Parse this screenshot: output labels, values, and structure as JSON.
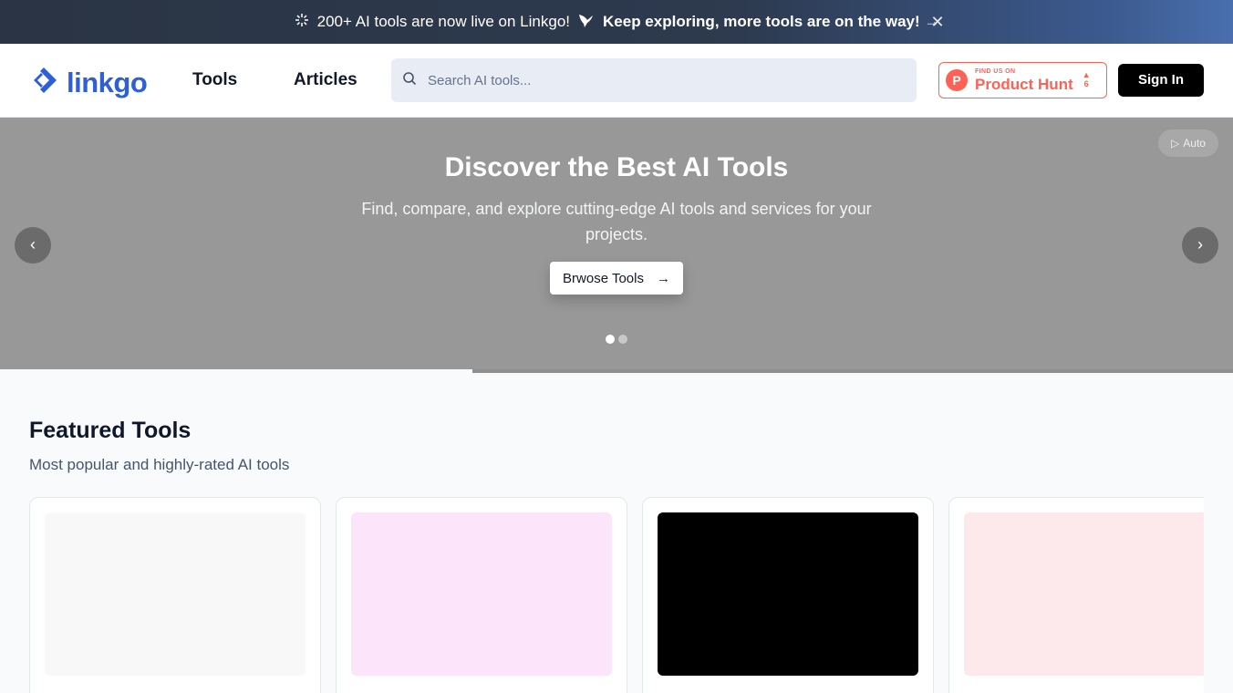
{
  "announcement": {
    "spark_icon": "sparkle-icon",
    "text_regular": "200+ AI tools are now live on Linkgo!",
    "bird_icon": "bird-icon",
    "text_bold": "Keep exploring, more tools are on the way! →",
    "close": "✕"
  },
  "header": {
    "logo_text": "linkgo",
    "nav": [
      {
        "label": "Tools"
      },
      {
        "label": "Articles"
      }
    ],
    "search_placeholder": "Search AI tools...",
    "product_hunt": {
      "letter": "P",
      "small": "FIND US ON",
      "big": "Product Hunt",
      "vote_arrow": "▲",
      "votes": "6"
    },
    "sign_in": "Sign In"
  },
  "hero": {
    "title": "Discover the Best AI Tools",
    "subtitle": "Find, compare, and explore cutting-edge AI tools and services for your projects.",
    "cta": "Brwose Tools",
    "cta_arrow": "→",
    "prev": "‹",
    "next": "›",
    "auto_icon": "▷",
    "auto_label": "Auto",
    "slides_total": 2,
    "active_slide": 1,
    "progress": 0.383
  },
  "featured": {
    "title": "Featured Tools",
    "subtitle": "Most popular and highly-rated AI tools",
    "cards": [
      {
        "thumb_color": "#f8f8f8"
      },
      {
        "thumb_color": "#fce4fb"
      },
      {
        "thumb_color": "#000000"
      },
      {
        "thumb_color": "#fde9ec"
      }
    ]
  },
  "colors": {
    "brand": "#2e5fd6",
    "product_hunt": "#ff6154",
    "hero_bg": "#989898"
  }
}
